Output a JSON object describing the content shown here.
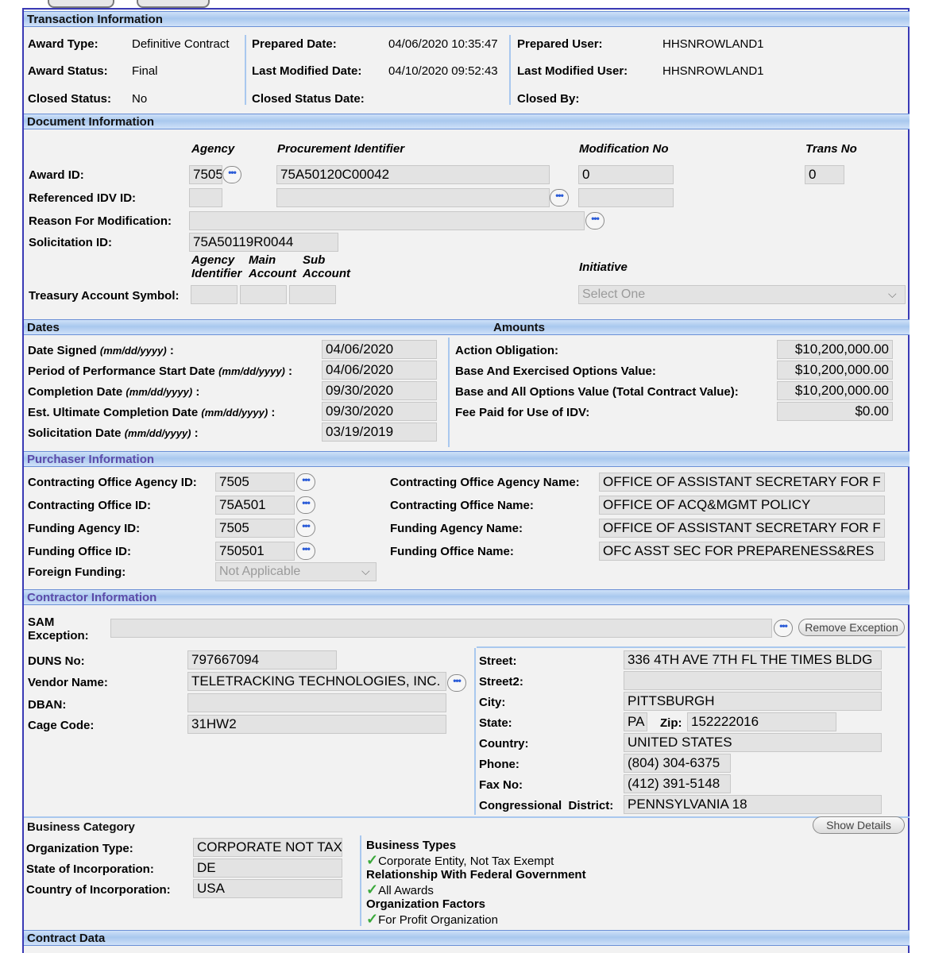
{
  "transaction": {
    "header": "Transaction Information",
    "award_type_label": "Award Type:",
    "award_type": "Definitive Contract",
    "award_status_label": "Award Status:",
    "award_status": "Final",
    "closed_status_label": "Closed Status:",
    "closed_status": "No",
    "prepared_date_label": "Prepared Date:",
    "prepared_date": "04/06/2020 10:35:47",
    "last_modified_date_label": "Last Modified Date:",
    "last_modified_date": "04/10/2020 09:52:43",
    "closed_status_date_label": "Closed Status Date:",
    "prepared_user_label": "Prepared User:",
    "prepared_user": "HHSNROWLAND1",
    "last_modified_user_label": "Last Modified User:",
    "last_modified_user": "HHSNROWLAND1",
    "closed_by_label": "Closed By:"
  },
  "document": {
    "header": "Document Information",
    "col_agency": "Agency",
    "col_procurement": "Procurement Identifier",
    "col_modification": "Modification No",
    "col_trans": "Trans No",
    "award_id_label": "Award ID:",
    "award_agency": "7505",
    "award_proc": "75A50120C00042",
    "award_mod": "0",
    "award_trans": "0",
    "ref_idv_label": "Referenced IDV ID:",
    "reason_label": "Reason For Modification:",
    "solicitation_label": "Solicitation ID:",
    "solicitation": "75A50119R0044",
    "tas_col1a": "Agency",
    "tas_col1b": "Identifier",
    "tas_col2a": "Main",
    "tas_col2b": "Account",
    "tas_col3a": "Sub",
    "tas_col3b": "Account",
    "initiative_label": "Initiative",
    "initiative_value": "Select One",
    "tas_label": "Treasury Account Symbol:"
  },
  "dates": {
    "header": "Dates",
    "date_format": "(mm/dd/yyyy)",
    "rows": [
      {
        "label": "Date Signed",
        "value": "04/06/2020"
      },
      {
        "label": "Period of Performance Start Date",
        "value": "04/06/2020"
      },
      {
        "label": "Completion Date",
        "value": "09/30/2020"
      },
      {
        "label": "Est. Ultimate Completion Date",
        "value": "09/30/2020"
      },
      {
        "label": "Solicitation Date",
        "value": "03/19/2019"
      }
    ]
  },
  "amounts": {
    "header": "Amounts",
    "rows": [
      {
        "label": "Action Obligation:",
        "value": "$10,200,000.00"
      },
      {
        "label": "Base And Exercised Options Value:",
        "value": "$10,200,000.00"
      },
      {
        "label": "Base and All Options Value (Total Contract Value):",
        "value": "$10,200,000.00"
      },
      {
        "label": "Fee Paid for Use of IDV:",
        "value": "$0.00"
      }
    ]
  },
  "purchaser": {
    "header": "Purchaser Information",
    "rows": [
      {
        "label": "Contracting Office Agency ID:",
        "value": "7505",
        "name_label": "Contracting Office Agency Name:",
        "name": "OFFICE OF ASSISTANT SECRETARY FOR F"
      },
      {
        "label": "Contracting Office ID:",
        "value": "75A501",
        "name_label": "Contracting Office Name:",
        "name": "OFFICE OF ACQ&MGMT POLICY"
      },
      {
        "label": "Funding Agency ID:",
        "value": "7505",
        "name_label": "Funding Agency Name:",
        "name": "OFFICE OF ASSISTANT SECRETARY FOR F"
      },
      {
        "label": "Funding Office ID:",
        "value": "750501",
        "name_label": "Funding Office Name:",
        "name": "OFC ASST SEC FOR PREPARENESS&RES"
      }
    ],
    "foreign_label": "Foreign Funding:",
    "foreign_value": "Not Applicable"
  },
  "contractor": {
    "header": "Contractor Information",
    "sam_label_1": "SAM",
    "sam_label_2": "Exception:",
    "remove_exception": "Remove Exception",
    "duns_label": "DUNS No:",
    "duns": "797667094",
    "vendor_label": "Vendor Name:",
    "vendor": "TELETRACKING TECHNOLOGIES, INC.",
    "dban_label": "DBAN:",
    "cage_label": "Cage Code:",
    "cage": "31HW2",
    "street_label": "Street:",
    "street": "336 4TH AVE 7TH FL THE TIMES BLDG",
    "street2_label": "Street2:",
    "city_label": "City:",
    "city": "PITTSBURGH",
    "state_label": "State:",
    "state": "PA",
    "zip_label": "Zip:",
    "zip": "152222016",
    "country_label": "Country:",
    "country": "UNITED STATES",
    "phone_label": "Phone:",
    "phone": "(804) 304-6375",
    "fax_label": "Fax No:",
    "fax": "(412) 391-5148",
    "district_label": "Congressional  District:",
    "district": "PENNSYLVANIA 18"
  },
  "business": {
    "header": "Business Category",
    "show_details": "Show Details",
    "org_type_label": "Organization Type:",
    "org_type": "CORPORATE NOT TAX",
    "state_inc_label": "State of Incorporation:",
    "state_inc": "DE",
    "country_inc_label": "Country of Incorporation:",
    "country_inc": "USA",
    "types_title": "Business Types",
    "types_item": "Corporate Entity, Not Tax Exempt",
    "relationship_title": "Relationship With Federal Government",
    "relationship_item": "All Awards",
    "factors_title": "Organization Factors",
    "factors_item": "For Profit Organization"
  },
  "contract_data": {
    "header": "Contract Data"
  }
}
